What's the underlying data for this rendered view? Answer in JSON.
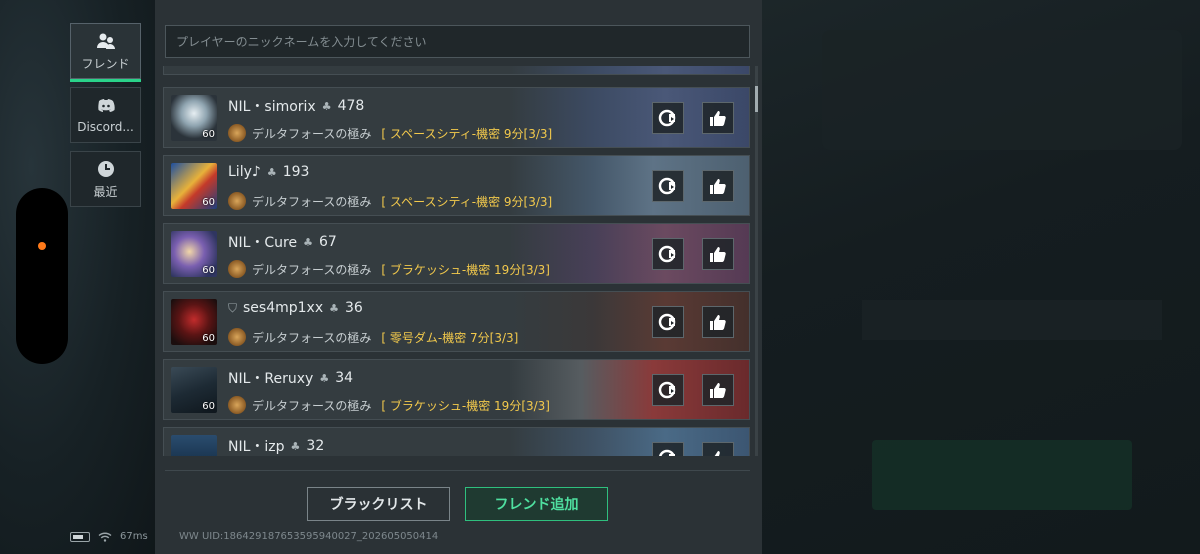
{
  "tabs": [
    {
      "label": "フレンド",
      "icon": "friends-icon",
      "active": true
    },
    {
      "label": "Discord...",
      "icon": "discord-icon",
      "active": false
    },
    {
      "label": "最近",
      "icon": "clock-icon",
      "active": false
    }
  ],
  "search": {
    "placeholder": "プレイヤーのニックネームを入力してください"
  },
  "friends": [
    {
      "name": "NIL・simorix",
      "score": "478",
      "level": "60",
      "rank": "デルタフォースの極み",
      "status": "[ スペースシティ-機密 9分[3/3]",
      "has_badge": false
    },
    {
      "name": "Lily♪",
      "score": "193",
      "level": "60",
      "rank": "デルタフォースの極み",
      "status": "[ スペースシティ-機密 9分[3/3]",
      "has_badge": false
    },
    {
      "name": "NIL・Cure",
      "score": "67",
      "level": "60",
      "rank": "デルタフォースの極み",
      "status": "[ ブラケッシュ-機密 19分[3/3]",
      "has_badge": false
    },
    {
      "name": "ses4mp1xx",
      "score": "36",
      "level": "60",
      "rank": "デルタフォースの極み",
      "status": "[ 零号ダム-機密 7分[3/3]",
      "has_badge": true
    },
    {
      "name": "NIL・Reruxy",
      "score": "34",
      "level": "60",
      "rank": "デルタフォースの極み",
      "status": "[ ブラケッシュ-機密 19分[3/3]",
      "has_badge": false
    },
    {
      "name": "NIL・izp",
      "score": "32",
      "level": "",
      "rank": "",
      "status": "",
      "has_badge": false
    }
  ],
  "buttons": {
    "blacklist": "ブラックリスト",
    "add_friend": "フレンド追加"
  },
  "status_bar": {
    "ping": "67ms"
  },
  "uid": "WW UID:1864291876535959400​27_202605050414",
  "colors": {
    "accent": "#2ad38a",
    "status_yellow": "#f2c94c",
    "recording_dot": "#ff7a1a"
  }
}
